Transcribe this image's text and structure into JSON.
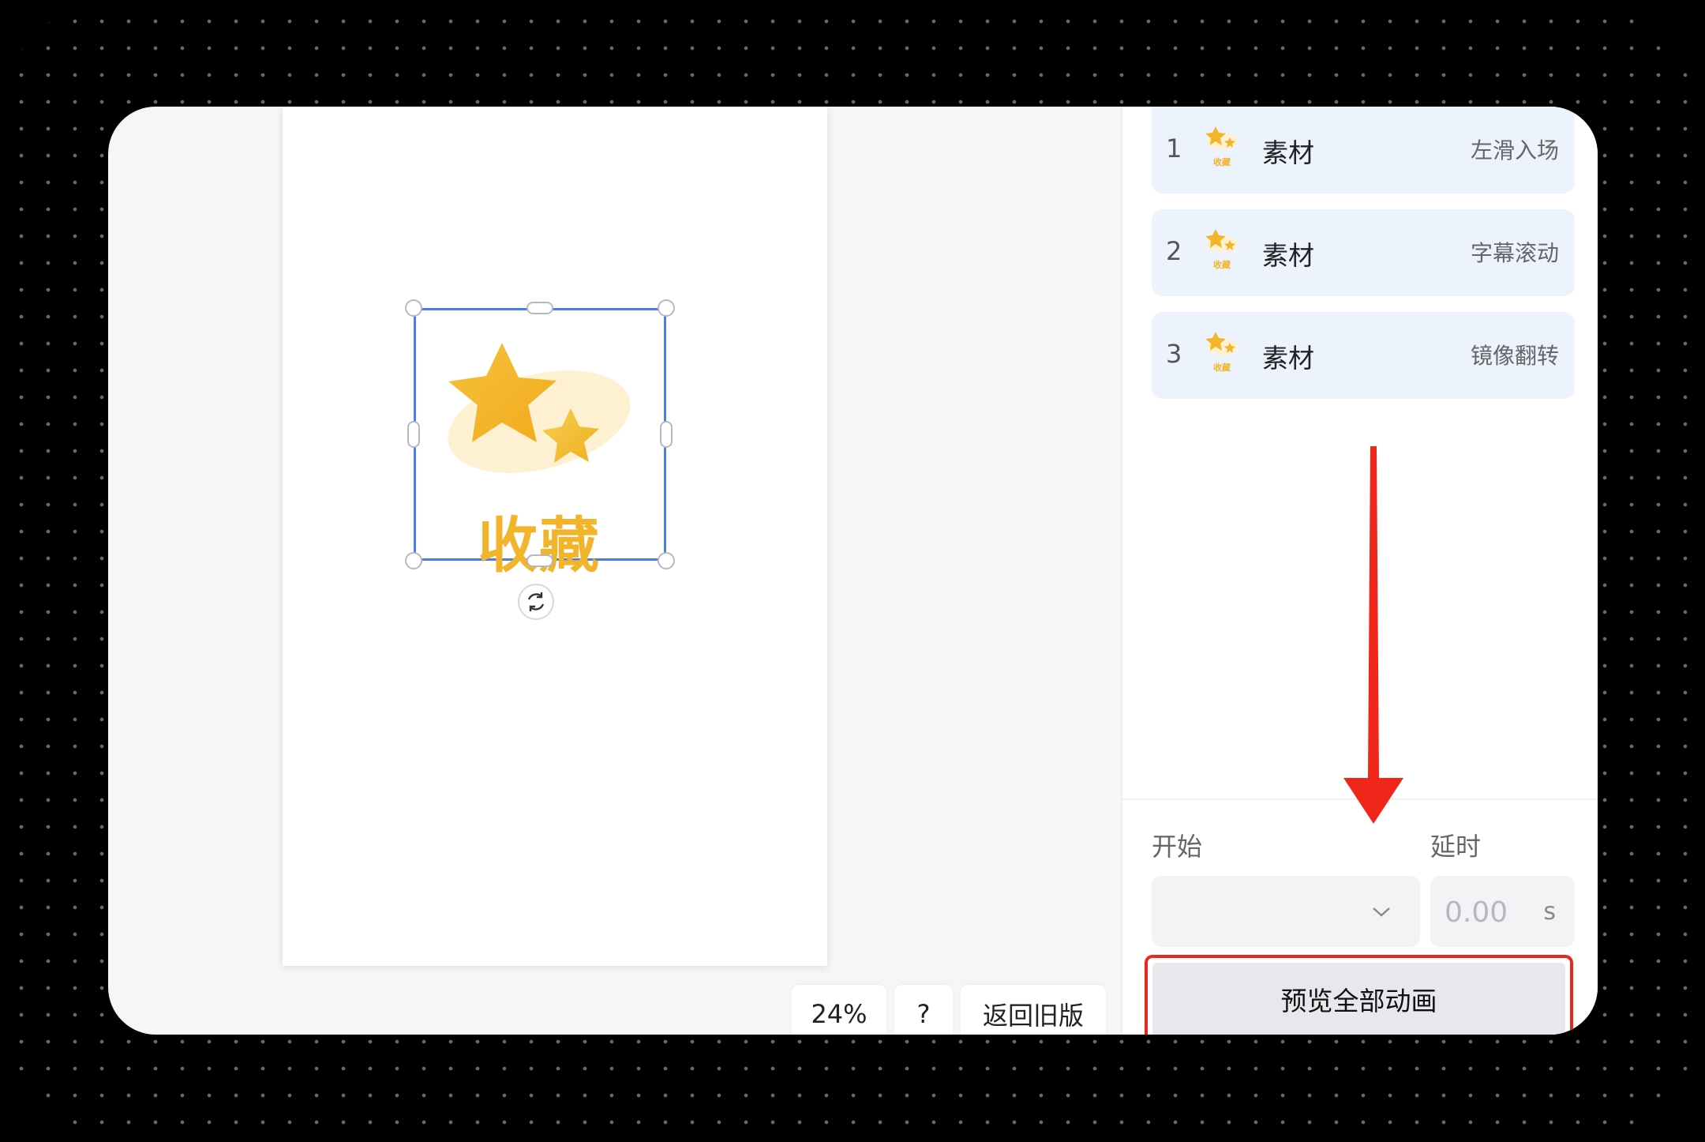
{
  "canvas": {
    "sticker_text": "收藏",
    "zoom": "24%",
    "help_label": "?",
    "old_version_label": "返回旧版"
  },
  "animations": [
    {
      "index": "1",
      "name": "素材",
      "thumb_text": "收藏",
      "effect": "左滑入场"
    },
    {
      "index": "2",
      "name": "素材",
      "thumb_text": "收藏",
      "effect": "字幕滚动"
    },
    {
      "index": "3",
      "name": "素材",
      "thumb_text": "收藏",
      "effect": "镜像翻转"
    }
  ],
  "settings": {
    "start_label": "开始",
    "delay_label": "延时",
    "start_value": "",
    "delay_value": "0.00",
    "delay_unit": "s"
  },
  "preview_label": "预览全部动画",
  "colors": {
    "selection": "#4a7cf0",
    "sticker_gold": "#f2b42a",
    "row_bg": "#edf3fd",
    "highlight": "#e8281c",
    "arrow": "#f0261a"
  }
}
